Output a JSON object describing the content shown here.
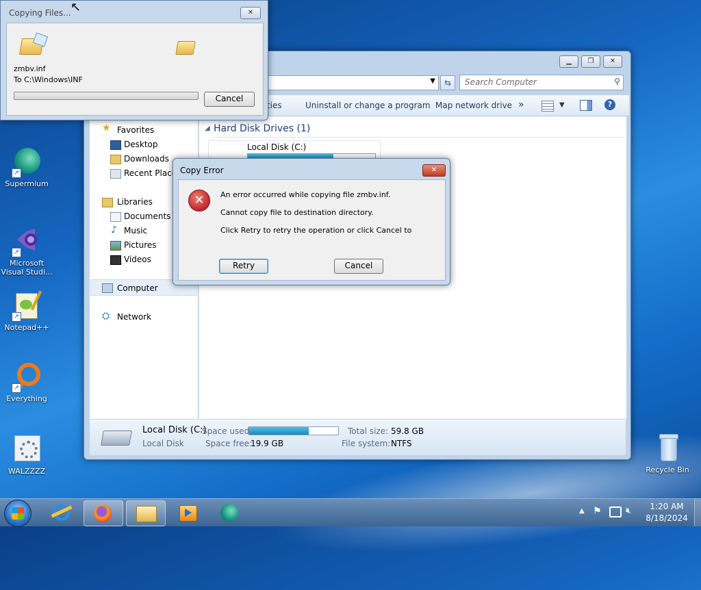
{
  "desktop": {
    "icons": [
      {
        "label": "Supermium"
      },
      {
        "label": "Microsoft Visual Studi..."
      },
      {
        "label": "Notepad++"
      },
      {
        "label": "Everything"
      },
      {
        "label": "WALZZZZ"
      },
      {
        "label": "Recycle Bin"
      }
    ]
  },
  "copying_dialog": {
    "title": "Copying Files...",
    "filename": "zmbv.inf",
    "destination": "To C:\\Windows\\INF",
    "progress_fraction": 0,
    "cancel_label": "Cancel"
  },
  "explorer": {
    "search_placeholder": "Search Computer",
    "toolbar": {
      "properties": "rties",
      "uninstall": "Uninstall or change a program",
      "map_drive": "Map network drive",
      "more": "»"
    },
    "nav": {
      "favorites": "Favorites",
      "desktop": "Desktop",
      "downloads": "Downloads",
      "recent": "Recent Places",
      "libraries": "Libraries",
      "documents": "Documents",
      "music": "Music",
      "pictures": "Pictures",
      "videos": "Videos",
      "computer": "Computer",
      "network": "Network"
    },
    "section_title": "Hard Disk Drives (1)",
    "drive_name": "Local Disk (C:)",
    "drive_usage_fraction": 0.67,
    "details": {
      "name": "Local Disk (C:)",
      "type": "Local Disk",
      "space_used_label": "Space used:",
      "space_free_label": "Space free:",
      "space_free_value": "19.9 GB",
      "total_size_label": "Total size:",
      "total_size_value": "59.8 GB",
      "fs_label": "File system:",
      "fs_value": "NTFS"
    }
  },
  "error_dialog": {
    "title": "Copy Error",
    "line1": "An error occurred while copying file zmbv.inf.",
    "line2": "Cannot copy file to destination directory.",
    "line3": "Click Retry to retry the operation or click Cancel to",
    "retry_label": "Retry",
    "cancel_label": "Cancel"
  },
  "taskbar": {
    "time": "1:20 AM",
    "date": "8/18/2024"
  },
  "colors": {
    "accent": "#1f6fc5",
    "error_red": "#c0282d",
    "progress": "#2fa3c8"
  }
}
